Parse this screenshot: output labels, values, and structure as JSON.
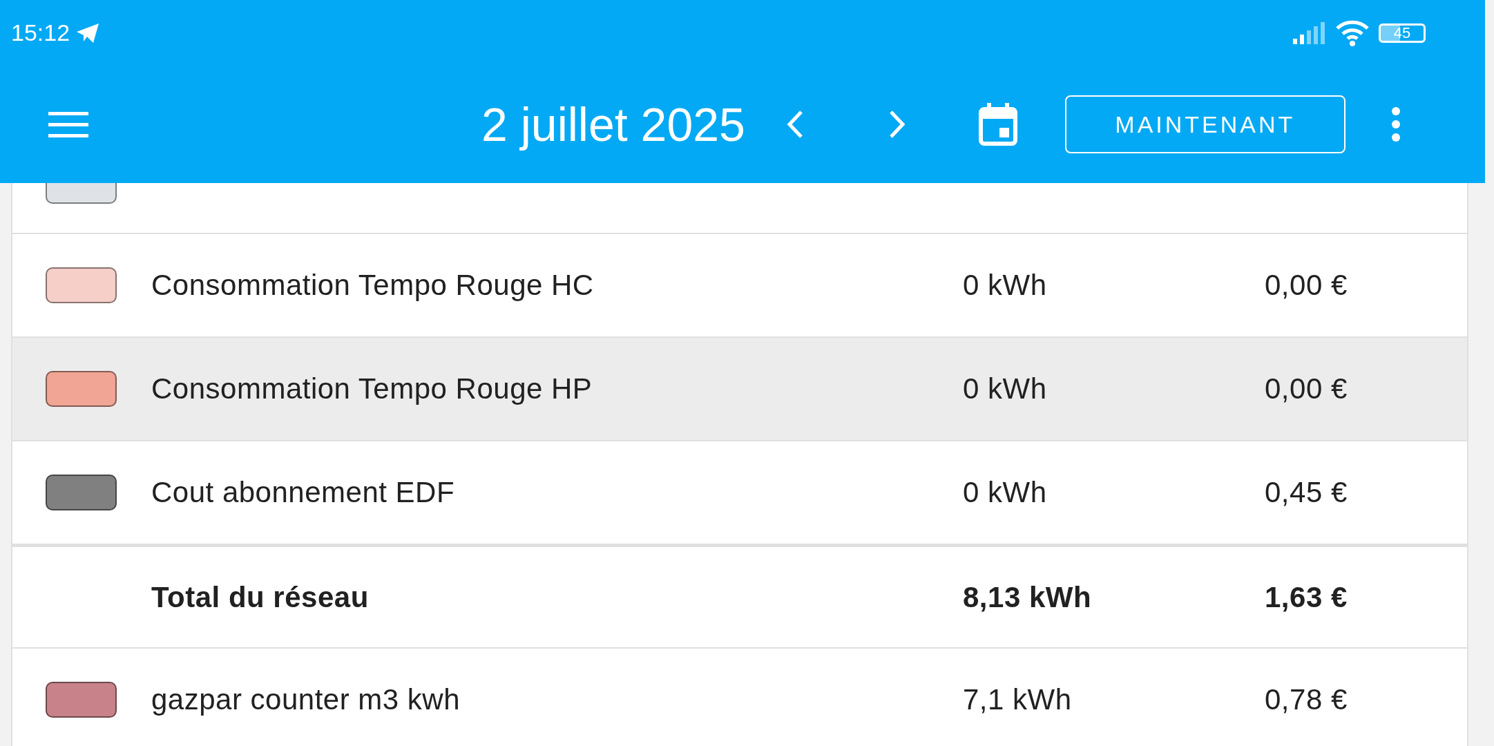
{
  "status_bar": {
    "time": "15:12",
    "battery": "45"
  },
  "app_bar": {
    "title": "2 juillet 2025",
    "now_button": "MAINTENANT"
  },
  "rows": [
    {
      "kind": "partial",
      "color": "#dfe3e7",
      "highlighted": false
    },
    {
      "kind": "source",
      "name": "Consommation Tempo Rouge HC",
      "energy": "0 kWh",
      "cost": "0,00 €",
      "color": "#f5cfc8",
      "highlighted": false
    },
    {
      "kind": "source",
      "name": "Consommation Tempo Rouge HP",
      "energy": "0 kWh",
      "cost": "0,00 €",
      "color": "#f0a595",
      "highlighted": true
    },
    {
      "kind": "source",
      "name": "Cout abonnement EDF",
      "energy": "0 kWh",
      "cost": "0,45 €",
      "color": "#808080",
      "highlighted": false
    },
    {
      "kind": "total",
      "name": "Total du réseau",
      "energy": "8,13 kWh",
      "cost": "1,63 €",
      "highlighted": false
    },
    {
      "kind": "source",
      "name": "gazpar counter m3 kwh",
      "energy": "7,1 kWh",
      "cost": "0,78 €",
      "color": "#c8828a",
      "highlighted": false
    }
  ]
}
